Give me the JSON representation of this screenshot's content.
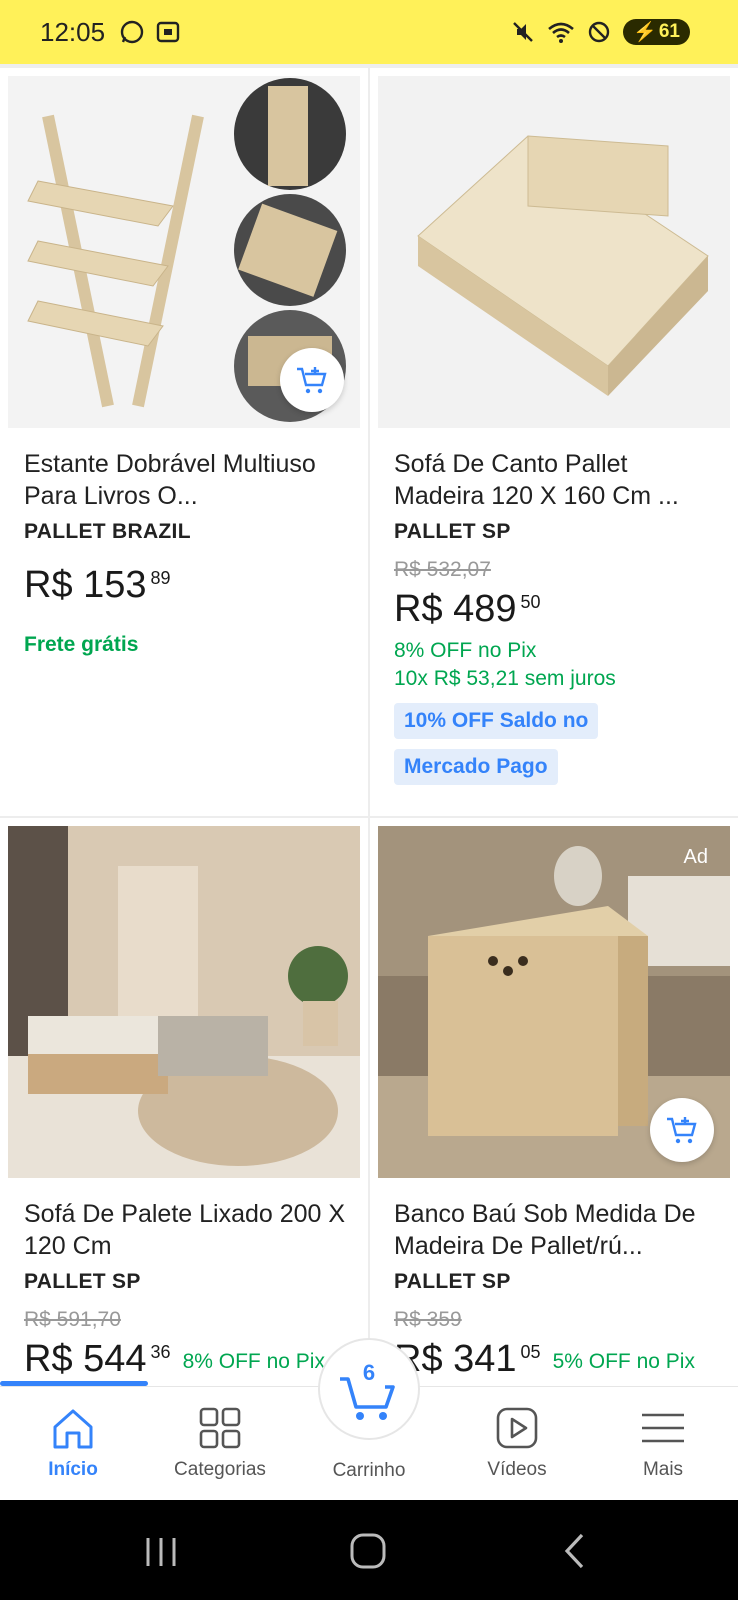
{
  "status": {
    "time": "12:05",
    "battery": "61"
  },
  "products": [
    {
      "title": "Estante Dobrável Multiuso Para Livros O...",
      "seller": "PALLET BRAZIL",
      "old_price": "",
      "price_int": "R$ 153",
      "price_cents": "89",
      "inline_off": "",
      "extras": [
        "Frete grátis"
      ],
      "promos": [],
      "ad": ""
    },
    {
      "title": "Sofá De Canto Pallet Madeira 120 X 160 Cm ...",
      "seller": "PALLET SP",
      "old_price": "R$ 532,07",
      "price_int": "R$ 489",
      "price_cents": "50",
      "inline_off": "",
      "extras": [
        "8% OFF no Pix",
        "10x R$ 53,21 sem juros"
      ],
      "promos": [
        "10% OFF Saldo no",
        "Mercado Pago"
      ],
      "ad": ""
    },
    {
      "title": "Sofá De Palete Lixado 200 X 120 Cm",
      "seller": "PALLET SP",
      "old_price": "R$ 591,70",
      "price_int": "R$ 544",
      "price_cents": "36",
      "inline_off": "8% OFF no Pix",
      "extras": [],
      "promos": [],
      "ad": ""
    },
    {
      "title": "Banco Baú Sob Medida De Madeira De Pallet/rú...",
      "seller": "PALLET SP",
      "old_price": "R$ 359",
      "price_int": "R$ 341",
      "price_cents": "05",
      "inline_off": "5% OFF no Pix",
      "extras": [],
      "promos": [],
      "ad": "Ad"
    }
  ],
  "nav": {
    "home": "Início",
    "categories": "Categorias",
    "cart": "Carrinho",
    "cart_count": "6",
    "videos": "Vídeos",
    "more": "Mais"
  },
  "colors": {
    "status_bar": "#fff159",
    "accent": "#3483fa",
    "green": "#00a650"
  }
}
